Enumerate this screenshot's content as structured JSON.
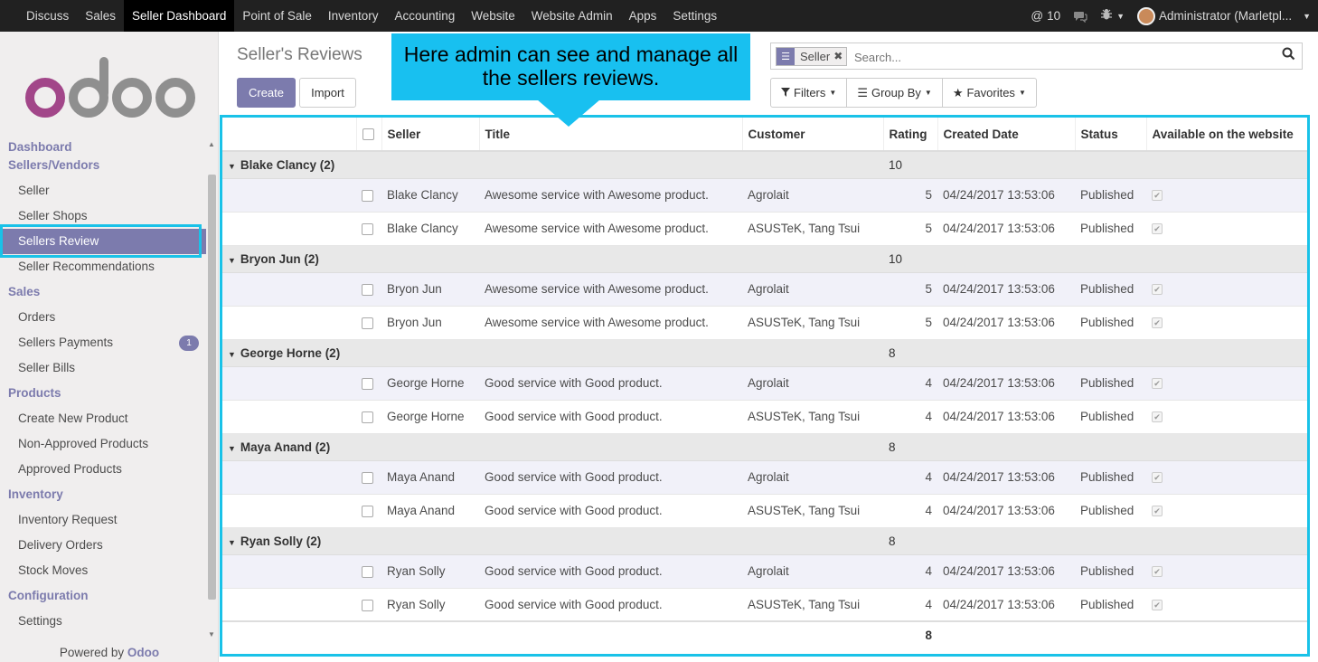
{
  "topbar": {
    "menu": [
      "Discuss",
      "Sales",
      "Seller Dashboard",
      "Point of Sale",
      "Inventory",
      "Accounting",
      "Website",
      "Website Admin",
      "Apps",
      "Settings"
    ],
    "active": "Seller Dashboard",
    "mentions_count": "10",
    "user": "Administrator (Marletpl..."
  },
  "logo_text": "odoo",
  "sidebar": {
    "sections": [
      {
        "title": "Dashboard",
        "items": []
      },
      {
        "title": "Sellers/Vendors",
        "items": [
          "Seller",
          "Seller Shops",
          "Sellers Review",
          "Seller Recommendations"
        ]
      },
      {
        "title": "Sales",
        "items": [
          "Orders",
          "Sellers Payments",
          "Seller Bills"
        ]
      },
      {
        "title": "Products",
        "items": [
          "Create New Product",
          "Non-Approved Products",
          "Approved Products"
        ]
      },
      {
        "title": "Inventory",
        "items": [
          "Inventory Request",
          "Delivery Orders",
          "Stock Moves"
        ]
      },
      {
        "title": "Configuration",
        "items": [
          "Settings"
        ]
      }
    ],
    "active_item": "Sellers Review",
    "payments_badge": "1",
    "powered_by": "Powered by",
    "powered_brand": "Odoo"
  },
  "control_panel": {
    "title": "Seller's Reviews",
    "create_label": "Create",
    "import_label": "Import",
    "search_facet": "Seller",
    "search_placeholder": "Search...",
    "filters_label": "Filters",
    "groupby_label": "Group By",
    "favorites_label": "Favorites"
  },
  "callout": "Here admin can see and manage all the sellers reviews.",
  "table": {
    "columns": [
      "Seller",
      "Title",
      "Customer",
      "Rating",
      "Created Date",
      "Status",
      "Available on the website"
    ],
    "groups": [
      {
        "label": "Blake Clancy (2)",
        "rating": "10",
        "rows": [
          {
            "seller": "Blake Clancy",
            "title": "Awesome service with Awesome product.",
            "customer": "Agrolait",
            "rating": "5",
            "date": "04/24/2017 13:53:06",
            "status": "Published"
          },
          {
            "seller": "Blake Clancy",
            "title": "Awesome service with Awesome product.",
            "customer": "ASUSTeK, Tang Tsui",
            "rating": "5",
            "date": "04/24/2017 13:53:06",
            "status": "Published"
          }
        ]
      },
      {
        "label": "Bryon Jun (2)",
        "rating": "10",
        "rows": [
          {
            "seller": "Bryon Jun",
            "title": "Awesome service with Awesome product.",
            "customer": "Agrolait",
            "rating": "5",
            "date": "04/24/2017 13:53:06",
            "status": "Published"
          },
          {
            "seller": "Bryon Jun",
            "title": "Awesome service with Awesome product.",
            "customer": "ASUSTeK, Tang Tsui",
            "rating": "5",
            "date": "04/24/2017 13:53:06",
            "status": "Published"
          }
        ]
      },
      {
        "label": "George Horne (2)",
        "rating": "8",
        "rows": [
          {
            "seller": "George Horne",
            "title": "Good service with Good product.",
            "customer": "Agrolait",
            "rating": "4",
            "date": "04/24/2017 13:53:06",
            "status": "Published"
          },
          {
            "seller": "George Horne",
            "title": "Good service with Good product.",
            "customer": "ASUSTeK, Tang Tsui",
            "rating": "4",
            "date": "04/24/2017 13:53:06",
            "status": "Published"
          }
        ]
      },
      {
        "label": "Maya Anand (2)",
        "rating": "8",
        "rows": [
          {
            "seller": "Maya Anand",
            "title": "Good service with Good product.",
            "customer": "Agrolait",
            "rating": "4",
            "date": "04/24/2017 13:53:06",
            "status": "Published"
          },
          {
            "seller": "Maya Anand",
            "title": "Good service with Good product.",
            "customer": "ASUSTeK, Tang Tsui",
            "rating": "4",
            "date": "04/24/2017 13:53:06",
            "status": "Published"
          }
        ]
      },
      {
        "label": "Ryan Solly (2)",
        "rating": "8",
        "rows": [
          {
            "seller": "Ryan Solly",
            "title": "Good service with Good product.",
            "customer": "Agrolait",
            "rating": "4",
            "date": "04/24/2017 13:53:06",
            "status": "Published"
          },
          {
            "seller": "Ryan Solly",
            "title": "Good service with Good product.",
            "customer": "ASUSTeK, Tang Tsui",
            "rating": "4",
            "date": "04/24/2017 13:53:06",
            "status": "Published"
          }
        ]
      }
    ],
    "total_rating": "8"
  },
  "colors": {
    "brand": "#7c7bad",
    "navbar": "#212121",
    "highlight": "#19c2e8"
  }
}
